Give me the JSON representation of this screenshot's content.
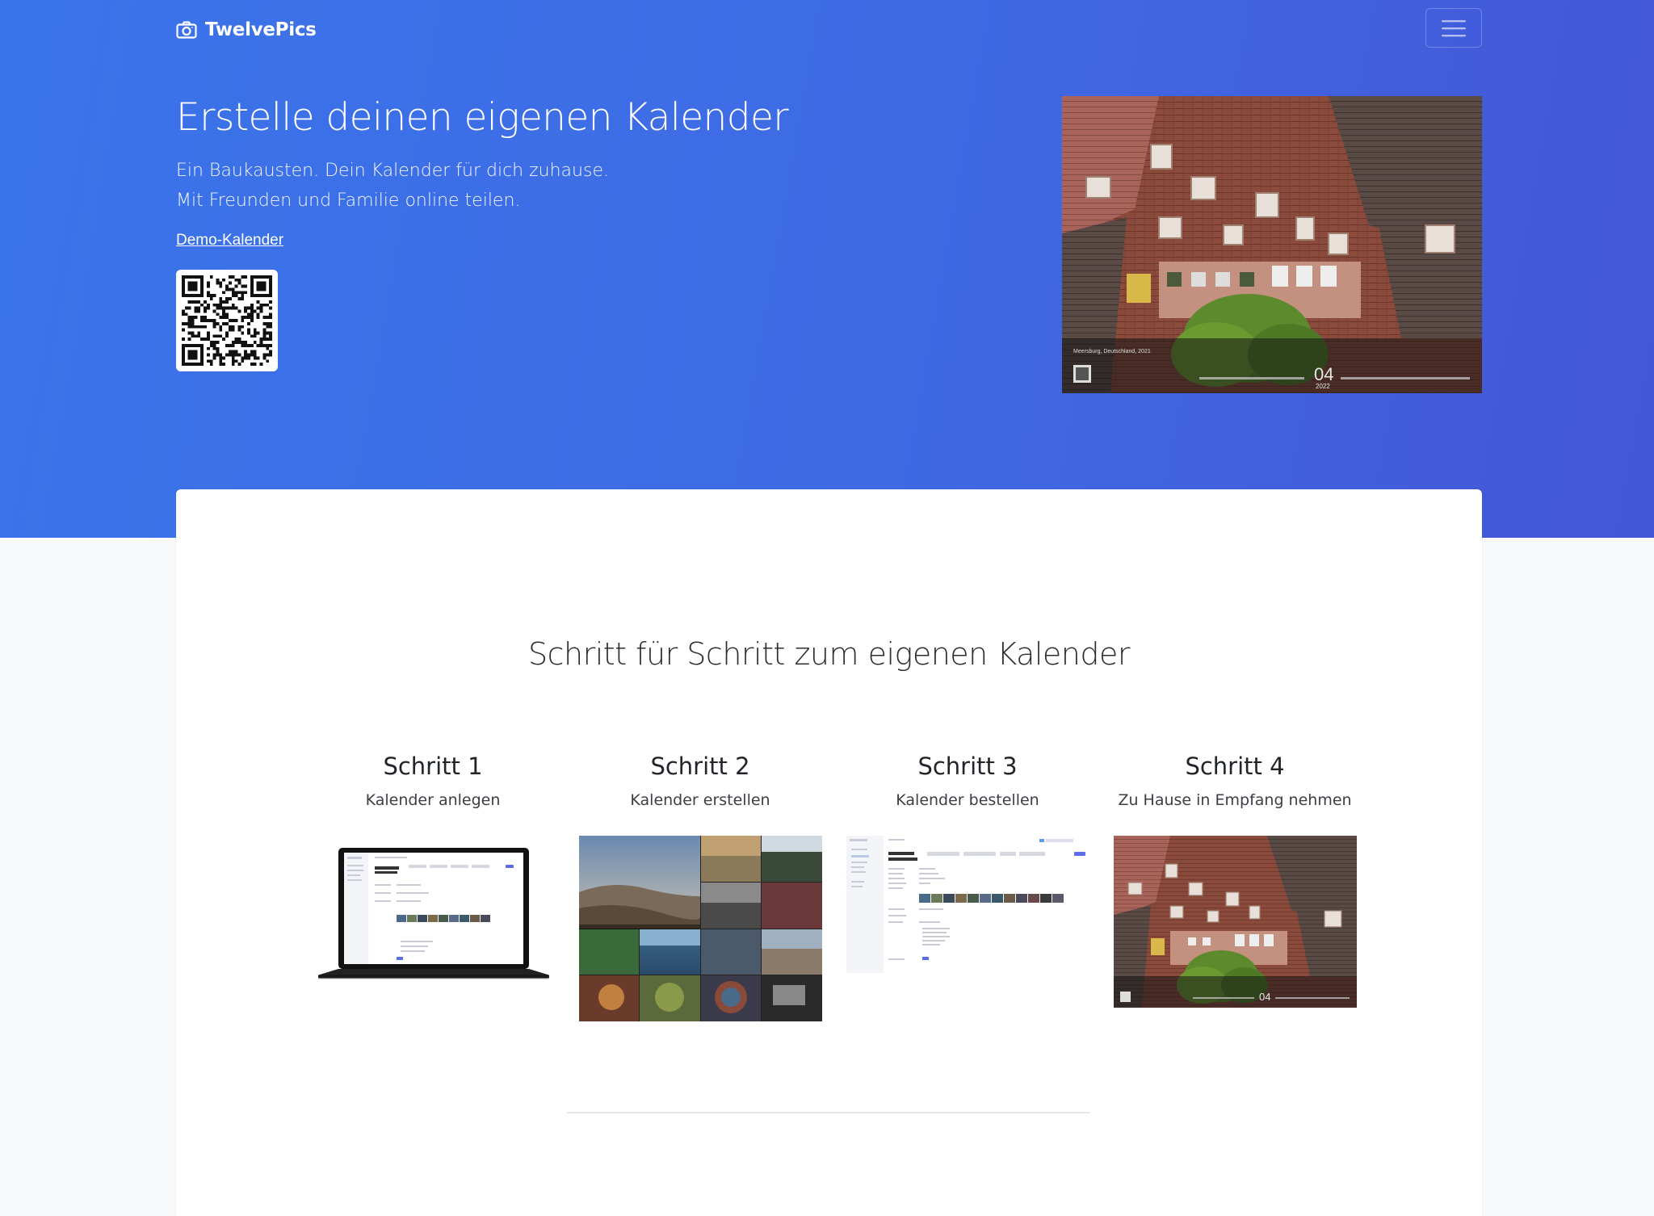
{
  "navbar": {
    "brand": "TwelvePics",
    "brand_icon": "camera-icon",
    "menu_icon": "hamburger-icon"
  },
  "hero": {
    "title": "Erstelle deinen eigenen Kalender",
    "lead_line1": "Ein Baukausten. Dein Kalender für dich zuhause.",
    "lead_line2": "Mit Freunden und Familie online teilen.",
    "demo_link": "Demo-Kalender",
    "photo_caption": "Meersburg, Deutschland, 2021",
    "photo_month": "04",
    "photo_year": "2022",
    "colors": {
      "gradient_start": "#3a74ea",
      "gradient_end": "#4356d6"
    }
  },
  "steps_section": {
    "title": "Schritt für Schritt zum eigenen Kalender",
    "steps": [
      {
        "title": "Schritt 1",
        "subtitle": "Kalender anlegen",
        "image": "laptop-screenshot"
      },
      {
        "title": "Schritt 2",
        "subtitle": "Kalender erstellen",
        "image": "photo-grid"
      },
      {
        "title": "Schritt 3",
        "subtitle": "Kalender bestellen",
        "image": "order-screenshot"
      },
      {
        "title": "Schritt 4",
        "subtitle": "Zu Hause in Empfang nehmen",
        "image": "calendar-photo"
      }
    ]
  }
}
